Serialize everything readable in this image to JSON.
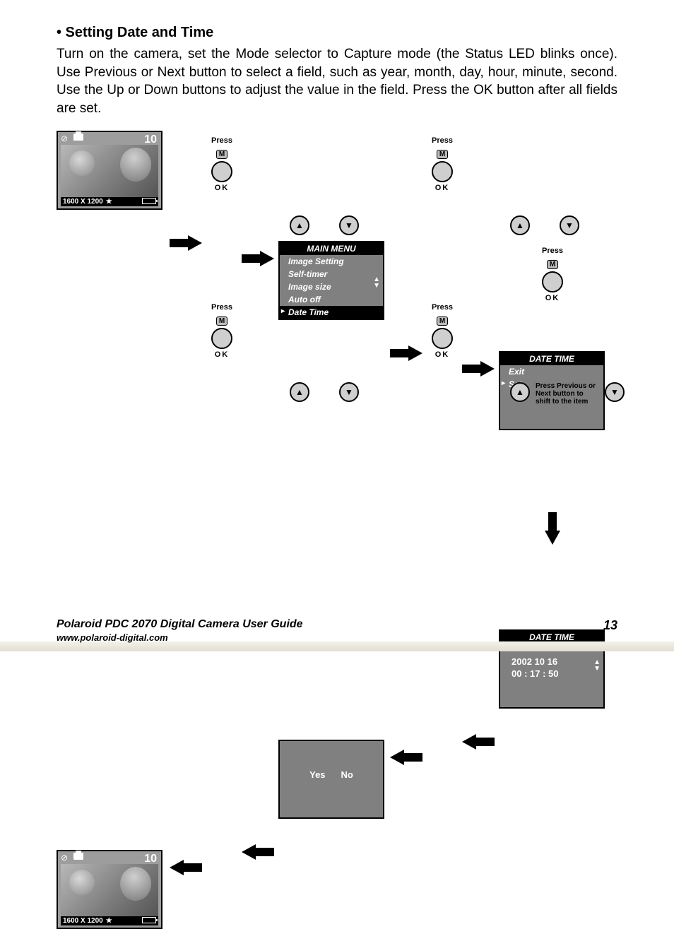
{
  "heading": "• Setting Date and Time",
  "body": "Turn on the camera, set the Mode selector to Capture mode (the Status LED blinks once). Use Previous or Next button to select a field, such as year, month, day, hour, minute, second. Use the Up or Down buttons to adjust the value in the field. Press the OK button after all fields are set.",
  "lcd": {
    "count": "10",
    "resolution": "1600 X 1200",
    "star": "★"
  },
  "press": "Press",
  "ok": "OK",
  "m": "M",
  "mainmenu": {
    "title": "MAIN MENU",
    "items": [
      "Image Setting",
      "Self-timer",
      "Image size",
      "Auto off",
      "Date Time"
    ]
  },
  "datetime_menu": {
    "title": "DATE TIME",
    "items": [
      "Exit",
      "Set"
    ]
  },
  "datetime_set": {
    "title": "DATE TIME",
    "date": "2002  10  16",
    "time": "00 : 17 : 50"
  },
  "confirm": {
    "yes": "Yes",
    "no": "No"
  },
  "hint": "Press Previous or Next button to shift to the item",
  "up": "▲",
  "down": "▼",
  "footer": {
    "guide": "Polaroid PDC 2070 Digital Camera User Guide",
    "url": "www.polaroid-digital.com",
    "page": "13"
  }
}
